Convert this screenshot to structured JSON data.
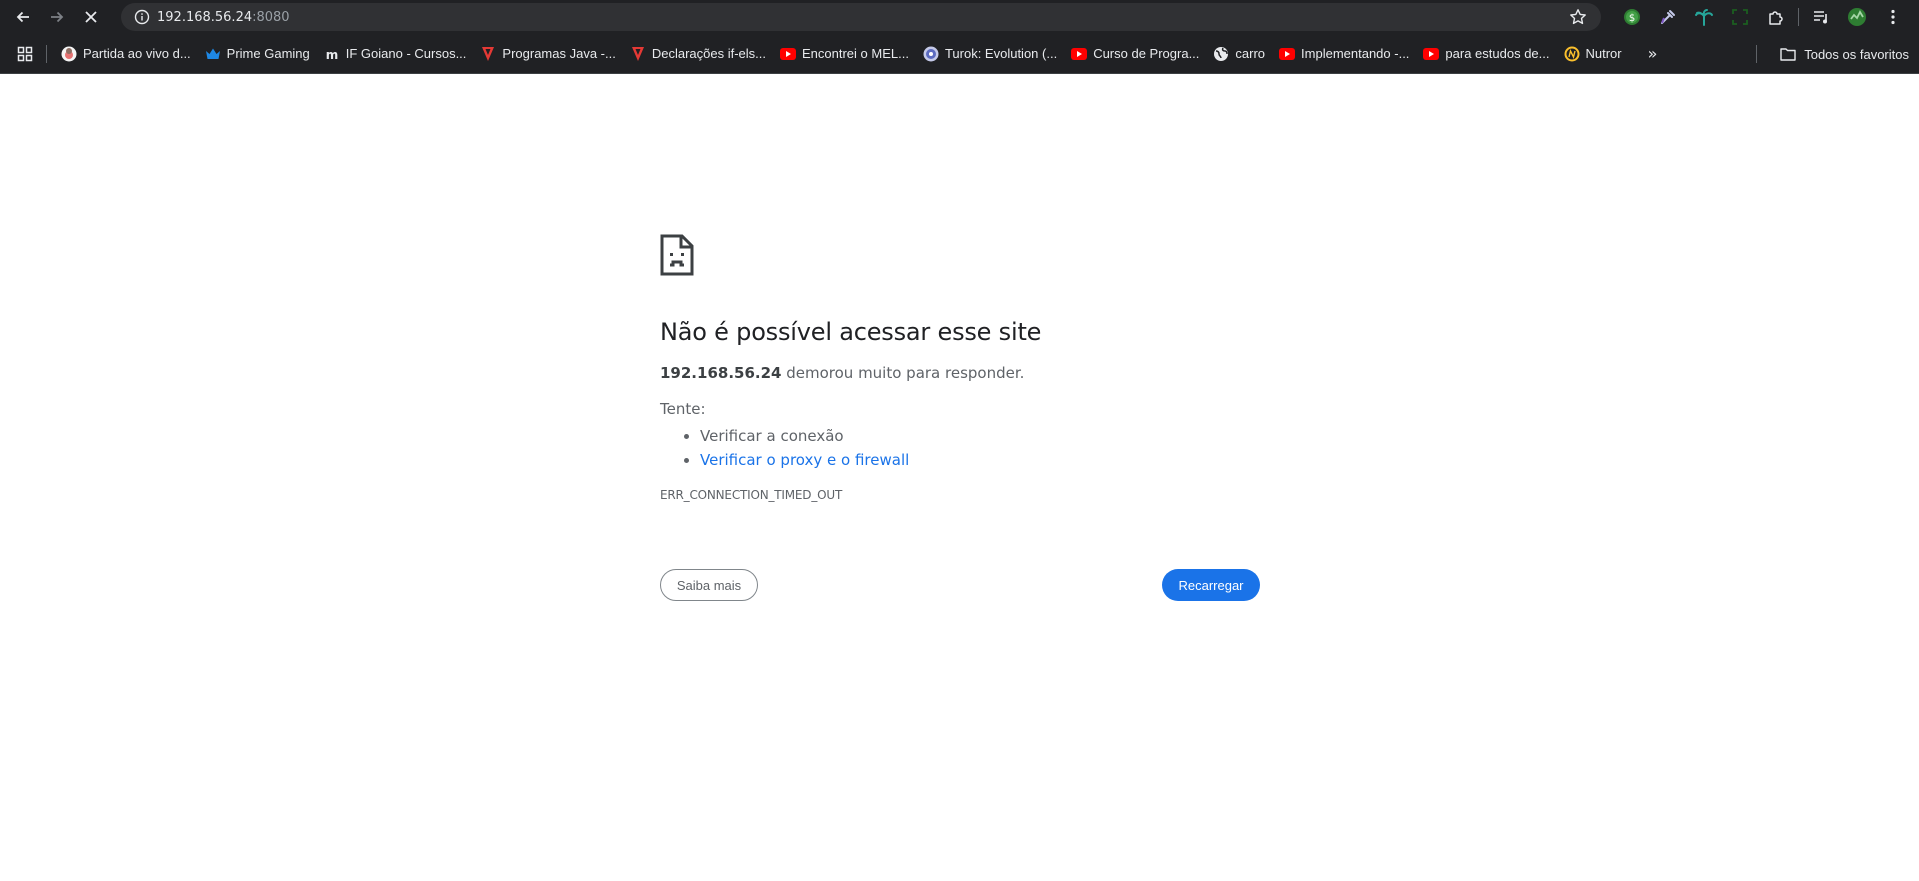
{
  "toolbar": {
    "url_host": "192.168.56.24",
    "url_port": ":8080",
    "icons": [
      "back-icon",
      "forward-icon",
      "stop-loading-icon",
      "site-info-icon",
      "bookmark-star-icon",
      "extensions-icon",
      "tab-search-icon",
      "profile-icon",
      "menu-icon"
    ]
  },
  "bookmarks": {
    "items": [
      {
        "label": "Partida ao vivo d...",
        "icon": "avatar-icon"
      },
      {
        "label": "Prime Gaming",
        "icon": "crown-icon"
      },
      {
        "label": "IF Goiano - Cursos...",
        "icon": "ifg-logo-icon"
      },
      {
        "label": "Programas Java -...",
        "icon": "red-triangle-icon"
      },
      {
        "label": "Declarações if-els...",
        "icon": "red-triangle-icon"
      },
      {
        "label": "Encontrei o MEL...",
        "icon": "youtube-icon"
      },
      {
        "label": "Turok: Evolution (...",
        "icon": "disc-icon"
      },
      {
        "label": "Curso de Progra...",
        "icon": "youtube-icon"
      },
      {
        "label": "carro",
        "icon": "globe-icon"
      },
      {
        "label": "Implementando -...",
        "icon": "youtube-icon"
      },
      {
        "label": "para estudos de...",
        "icon": "youtube-icon"
      },
      {
        "label": "Nutror",
        "icon": "nutror-icon"
      }
    ],
    "more": "»",
    "all_bookmarks": "Todos os favoritos"
  },
  "error": {
    "title": "Não é possível acessar esse site",
    "host": "192.168.56.24",
    "message": " demorou muito para responder.",
    "try_label": "Tente:",
    "suggestions": [
      "Verificar a conexão",
      "Verificar o proxy e o firewall"
    ],
    "code": "ERR_CONNECTION_TIMED_OUT",
    "more_button": "Saiba mais",
    "reload_button": "Recarregar"
  },
  "colors": {
    "chrome_bg": "#202124",
    "link": "#1a73e8",
    "primary_button": "#1a73e8"
  }
}
